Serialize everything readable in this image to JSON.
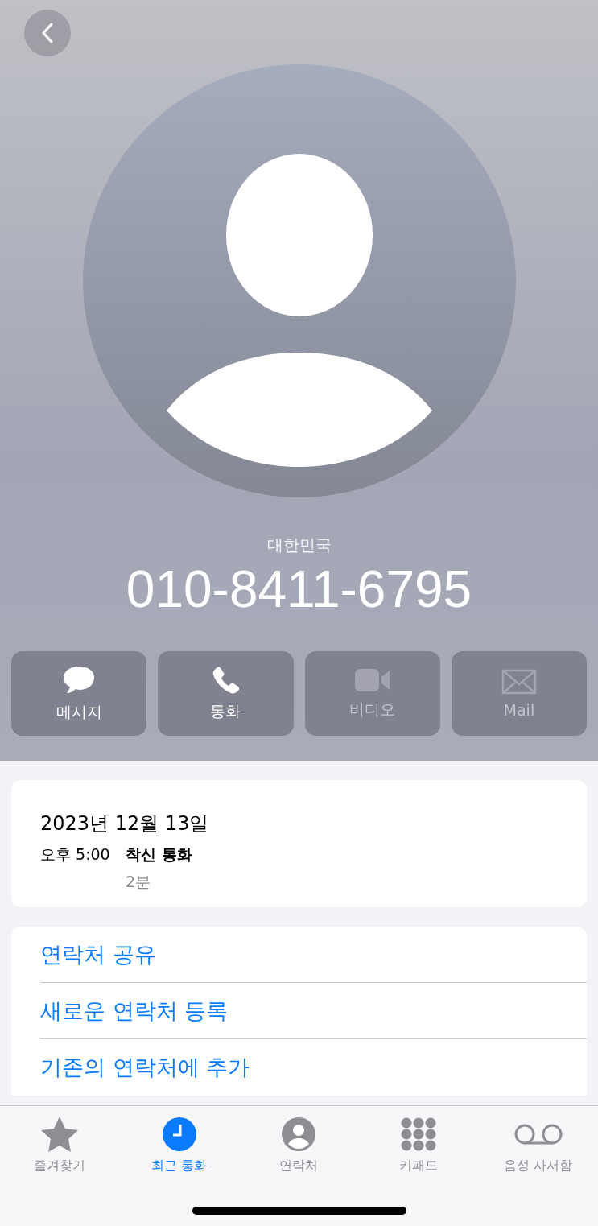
{
  "header": {
    "country": "대한민국",
    "number": "010-8411-6795"
  },
  "actions": [
    {
      "kind": "message",
      "label": "메시지",
      "disabled": false
    },
    {
      "kind": "call",
      "label": "통화",
      "disabled": false
    },
    {
      "kind": "video",
      "label": "비디오",
      "disabled": true
    },
    {
      "kind": "mail",
      "label": "Mail",
      "disabled": true
    }
  ],
  "call_log": {
    "date": "2023년 12월 13일",
    "entries": [
      {
        "time": "오후 5:00",
        "type": "착신 통화",
        "duration": "2분"
      }
    ]
  },
  "options": [
    "연락처 공유",
    "새로운 연락처 등록",
    "기존의 연락처에 추가"
  ],
  "tabs": [
    {
      "kind": "favorites",
      "label": "즐겨찾기",
      "selected": false
    },
    {
      "kind": "recents",
      "label": "최근 통화",
      "selected": true
    },
    {
      "kind": "contacts",
      "label": "연락처",
      "selected": false
    },
    {
      "kind": "keypad",
      "label": "키패드",
      "selected": false
    },
    {
      "kind": "voicemail",
      "label": "음성 사서함",
      "selected": false
    }
  ]
}
